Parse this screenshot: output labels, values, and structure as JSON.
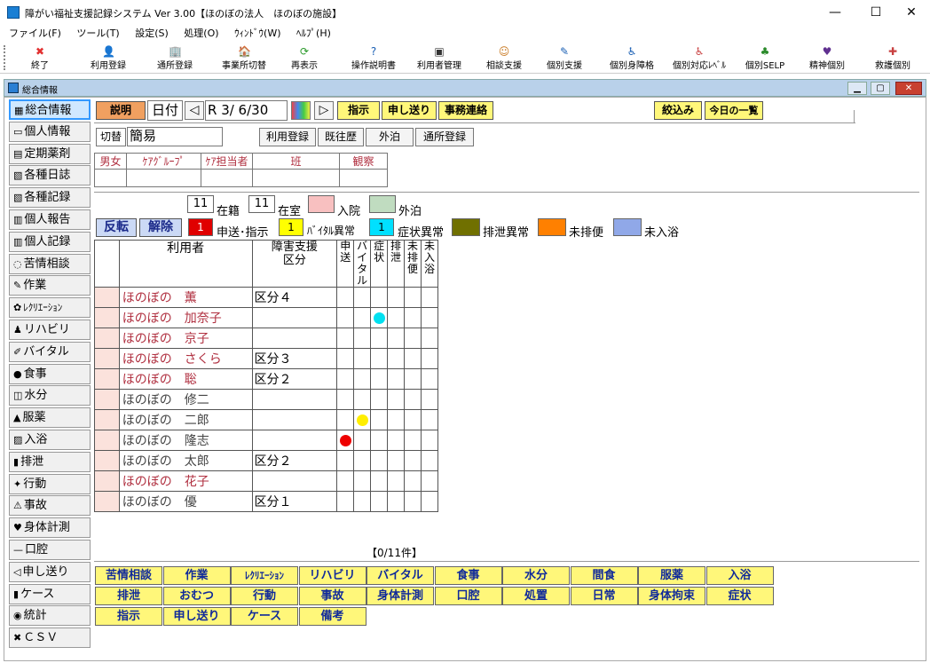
{
  "window": {
    "title": "障がい福祉支援記録システム Ver 3.00【ほのぼの法人　ほのぼの施設】",
    "minimize": "—",
    "maximize": "☐",
    "close": "✕"
  },
  "menu": [
    "ファイル(F)",
    "ツール(T)",
    "設定(S)",
    "処理(O)",
    "ｳｨﾝﾄﾞｳ(W)",
    "ﾍﾙﾌﾟ(H)"
  ],
  "toolbar": [
    {
      "label": "終了",
      "icon": "close-x-icon",
      "glyph": "✖",
      "color": "#e23030"
    },
    {
      "label": "利用登録",
      "icon": "person-icon",
      "glyph": "👤",
      "color": "#333"
    },
    {
      "label": "通所登録",
      "icon": "building-icon",
      "glyph": "🏢",
      "color": "#666"
    },
    {
      "label": "事業所切替",
      "icon": "office-switch-icon",
      "glyph": "🏠",
      "color": "#666"
    },
    {
      "label": "再表示",
      "icon": "refresh-icon",
      "glyph": "⟳",
      "color": "#2a9a2a"
    },
    {
      "label": "操作説明書",
      "icon": "help-icon",
      "glyph": "?",
      "color": "#1a5fb4"
    },
    {
      "label": "利用者管理",
      "icon": "user-card-icon",
      "glyph": "▣",
      "color": "#333"
    },
    {
      "label": "相談支援",
      "icon": "consult-icon",
      "glyph": "☺",
      "color": "#c87820"
    },
    {
      "label": "個別支援",
      "icon": "individual-support-icon",
      "glyph": "✎",
      "color": "#1a5fb4"
    },
    {
      "label": "個別身障格",
      "icon": "disability-icon",
      "glyph": "♿",
      "color": "#1a5fb4"
    },
    {
      "label": "個別対応ﾚﾍﾞﾙ",
      "icon": "level-icon",
      "glyph": "♿",
      "color": "#c84040"
    },
    {
      "label": "個別SELP",
      "icon": "selp-icon",
      "glyph": "♣",
      "color": "#2a8a2a"
    },
    {
      "label": "精神個別",
      "icon": "mental-icon",
      "glyph": "♥",
      "color": "#603090"
    },
    {
      "label": "救護個別",
      "icon": "relief-icon",
      "glyph": "✚",
      "color": "#c84040"
    }
  ],
  "mdi": {
    "title": "総合情報"
  },
  "sidebar": [
    {
      "label": "総合情報",
      "icon": "overview-icon",
      "glyph": "▦",
      "selected": true
    },
    {
      "label": "個人情報",
      "icon": "folder-icon",
      "glyph": "▭"
    },
    {
      "label": "定期薬剤",
      "icon": "memo-icon",
      "glyph": "▤"
    },
    {
      "label": "各種日誌",
      "icon": "diary-icon",
      "glyph": "▧"
    },
    {
      "label": "各種記録",
      "icon": "record-icon",
      "glyph": "▧"
    },
    {
      "label": "個人報告",
      "icon": "report-icon",
      "glyph": "▥"
    },
    {
      "label": "個人記録",
      "icon": "personal-record-icon",
      "glyph": "▥"
    },
    {
      "label": "苦情相談",
      "icon": "speech-bubble-icon",
      "glyph": "◌"
    },
    {
      "label": "作業",
      "icon": "work-icon",
      "glyph": "✎"
    },
    {
      "label": "ﾚｸﾘｴｰｼｮﾝ",
      "icon": "recreation-icon",
      "glyph": "✿"
    },
    {
      "label": "リハビリ",
      "icon": "rehab-icon",
      "glyph": "♟"
    },
    {
      "label": "バイタル",
      "icon": "vital-icon",
      "glyph": "✐"
    },
    {
      "label": "食事",
      "icon": "apple-icon",
      "glyph": "●"
    },
    {
      "label": "水分",
      "icon": "cup-icon",
      "glyph": "◫"
    },
    {
      "label": "服薬",
      "icon": "medicine-icon",
      "glyph": "▲"
    },
    {
      "label": "入浴",
      "icon": "bath-icon",
      "glyph": "▨"
    },
    {
      "label": "排泄",
      "icon": "toilet-icon",
      "glyph": "▮"
    },
    {
      "label": "行動",
      "icon": "action-icon",
      "glyph": "✦"
    },
    {
      "label": "事故",
      "icon": "warning-icon",
      "glyph": "⚠"
    },
    {
      "label": "身体計測",
      "icon": "heart-icon",
      "glyph": "♥"
    },
    {
      "label": "口腔",
      "icon": "mouth-icon",
      "glyph": "—"
    },
    {
      "label": "申し送り",
      "icon": "speaker-icon",
      "glyph": "◁"
    },
    {
      "label": "ケース",
      "icon": "case-icon",
      "glyph": "▮"
    },
    {
      "label": "統計",
      "icon": "chart-icon",
      "glyph": "◉"
    },
    {
      "label": "ＣＳＶ",
      "icon": "csv-icon",
      "glyph": "✖"
    }
  ],
  "header": {
    "explain": "説明",
    "date_label": "日付",
    "date_value": "R 3/ 6/30",
    "prev": "◁",
    "next": "▷",
    "instruct": "指示",
    "handover": "申し送り",
    "office_contact": "事務連絡",
    "filter": "絞込み",
    "today_list": "今日の一覧",
    "switch": "切替",
    "mode": "簡易",
    "reg_use": "利用登録",
    "history": "既往歴",
    "outing": "外泊",
    "attend_reg": "通所登録"
  },
  "filter_table": {
    "headers": [
      "男女",
      "ｹｱｸﾞﾙｰﾌﾟ",
      "ｹｱ担当者",
      "班",
      "観察"
    ],
    "values": [
      "",
      "",
      "",
      "",
      ""
    ]
  },
  "status": {
    "enrolled_count": "11",
    "enrolled_label": "在籍",
    "present_count": "11",
    "present_label": "在室",
    "hospital_label": "入院",
    "outing_label": "外泊",
    "flip": "反転",
    "release": "解除",
    "handover_count": "1",
    "handover_label": "申送･指示",
    "vital_count": "1",
    "vital_label": "ﾊﾞｲﾀﾙ異常",
    "symptom_count": "1",
    "symptom_label": "症状異常",
    "excretion_label": "排泄異常",
    "not_excreted_label": "未排便",
    "not_bathed_label": "未入浴",
    "colors": {
      "hospital": "#f8c0c0",
      "outing": "#c0dcc0",
      "handover": "#e00000",
      "vital": "#ffff00",
      "symptom": "#00e0ff",
      "excretion": "#707000",
      "not_excreted": "#ff8000",
      "not_bathed": "#90a8e8"
    }
  },
  "grid": {
    "headers": {
      "user": "利用者",
      "category": "障害支援\n区分",
      "handover": "申\n送",
      "vital": "バ\nイ\nタ\nル",
      "symptom": "症\n状",
      "excretion": "排\n泄",
      "not_excreted": "未\n排\n便",
      "not_bathed": "未\n入\n浴"
    },
    "rows": [
      {
        "name": "ほのぼの　薫",
        "category": "区分４",
        "gray": false,
        "marks": [
          "",
          "",
          "",
          "",
          "",
          ""
        ]
      },
      {
        "name": "ほのぼの　加奈子",
        "category": "",
        "gray": false,
        "marks": [
          "",
          "",
          "cyan",
          "",
          "",
          ""
        ]
      },
      {
        "name": "ほのぼの　京子",
        "category": "",
        "gray": false,
        "marks": [
          "",
          "",
          "",
          "",
          "",
          ""
        ]
      },
      {
        "name": "ほのぼの　さくら",
        "category": "区分３",
        "gray": false,
        "marks": [
          "",
          "",
          "",
          "",
          "",
          ""
        ]
      },
      {
        "name": "ほのぼの　聡",
        "category": "区分２",
        "gray": false,
        "marks": [
          "",
          "",
          "",
          "",
          "",
          ""
        ]
      },
      {
        "name": "ほのぼの　修二",
        "category": "",
        "gray": true,
        "marks": [
          "",
          "",
          "",
          "",
          "",
          ""
        ]
      },
      {
        "name": "ほのぼの　二郎",
        "category": "",
        "gray": true,
        "marks": [
          "",
          "yellow",
          "",
          "",
          "",
          ""
        ]
      },
      {
        "name": "ほのぼの　隆志",
        "category": "",
        "gray": true,
        "marks": [
          "red",
          "",
          "",
          "",
          "",
          ""
        ]
      },
      {
        "name": "ほのぼの　太郎",
        "category": "区分２",
        "gray": true,
        "marks": [
          "",
          "",
          "",
          "",
          "",
          ""
        ]
      },
      {
        "name": "ほのぼの　花子",
        "category": "",
        "gray": false,
        "marks": [
          "",
          "",
          "",
          "",
          "",
          ""
        ]
      },
      {
        "name": "ほのぼの　優",
        "category": "区分１",
        "gray": true,
        "marks": [
          "",
          "",
          "",
          "",
          "",
          ""
        ]
      }
    ],
    "count_text": "【0/11件】"
  },
  "bottom_buttons": [
    [
      "苦情相談",
      "作業",
      "ﾚｸﾘｴｰｼｮﾝ",
      "リハビリ",
      "バイタル",
      "食事",
      "水分",
      "間食",
      "服薬",
      "入浴"
    ],
    [
      "排泄",
      "おむつ",
      "行動",
      "事故",
      "身体計測",
      "口腔",
      "処置",
      "日常",
      "身体拘束",
      "症状"
    ],
    [
      "指示",
      "申し送り",
      "ケース",
      "備考"
    ]
  ]
}
